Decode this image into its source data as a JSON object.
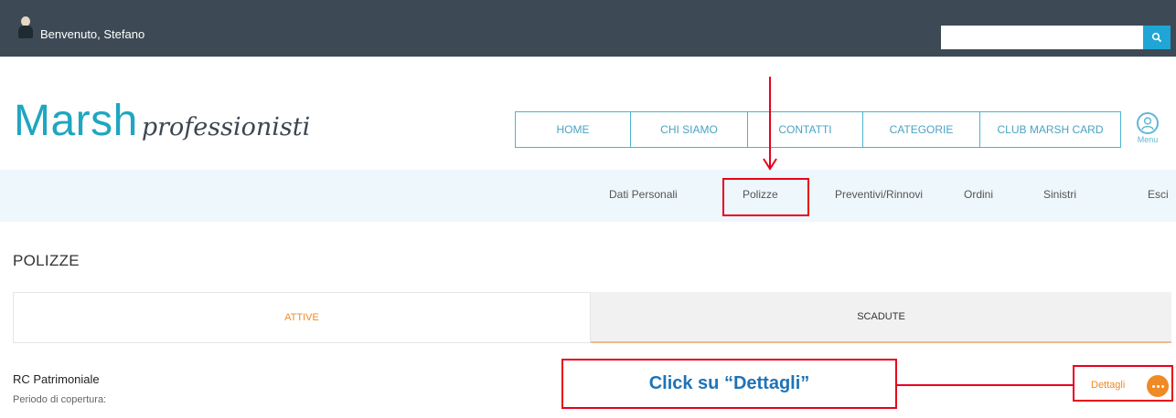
{
  "topbar": {
    "welcome_text": "Benvenuto, Stefano",
    "search_placeholder": "",
    "search_icon": "search-icon"
  },
  "logo": {
    "main": "Marsh",
    "sub": "professionisti"
  },
  "main_nav": [
    {
      "label": "HOME"
    },
    {
      "label": "CHI SIAMO"
    },
    {
      "label": "CONTATTI"
    },
    {
      "label": "CATEGORIE"
    },
    {
      "label": "CLUB MARSH CARD"
    }
  ],
  "menu_label": "Menu",
  "sub_nav": [
    {
      "label": "Dati Personali"
    },
    {
      "label": "Polizze"
    },
    {
      "label": "Preventivi/Rinnovi"
    },
    {
      "label": "Ordini"
    },
    {
      "label": "Sinistri"
    },
    {
      "label": "Esci"
    }
  ],
  "page_title": "POLIZZE",
  "tabs": {
    "active": "ATTIVE",
    "inactive": "SCADUTE"
  },
  "policy": {
    "name": "RC Patrimoniale",
    "period_label": "Periodo di copertura:",
    "details_label": "Dettagli"
  },
  "annotation": {
    "callout_text": "Click su “Dettagli”"
  },
  "colors": {
    "topbar": "#3d4a55",
    "brand": "#1fa6c0",
    "accent_orange": "#f08a24",
    "annotation_red": "#e8001c",
    "callout_text": "#1f73b7"
  }
}
